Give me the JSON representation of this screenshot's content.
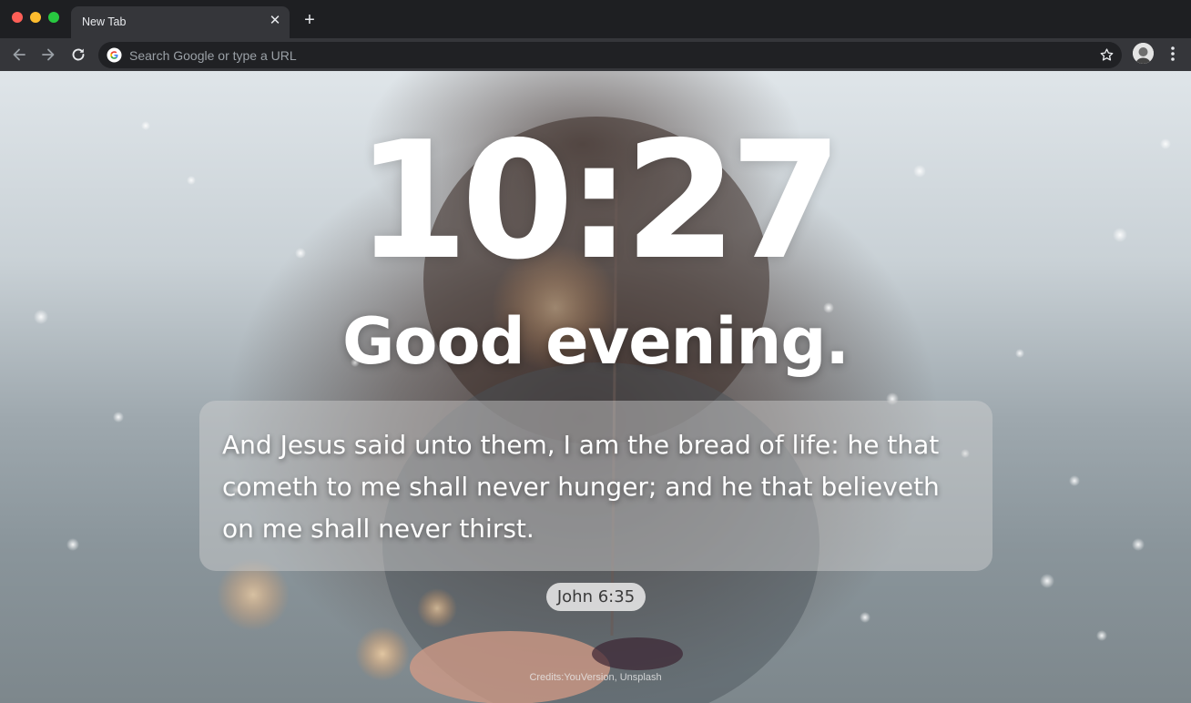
{
  "browser": {
    "tab": {
      "title": "New Tab"
    },
    "omnibox": {
      "placeholder": "Search Google or type a URL"
    },
    "icons": {
      "back": "arrow-left-icon",
      "forward": "arrow-right-icon",
      "reload": "reload-icon",
      "google": "google-g-icon",
      "bookmark": "star-icon",
      "profile": "avatar",
      "menu": "kebab-menu-icon",
      "close": "close-icon",
      "new_tab": "plus-icon"
    }
  },
  "page": {
    "clock": "10:27",
    "greeting": "Good evening.",
    "verse": {
      "text": "And Jesus said unto them, I am the bread of life: he that cometh to me shall never hunger; and he that believeth on me shall never thirst.",
      "reference": "John 6:35"
    },
    "credits": "Credits:YouVersion, Unsplash"
  },
  "colors": {
    "chrome_dark": "#1e1f22",
    "toolbar": "#35363a",
    "omnibox": "#202124",
    "text_white": "#ffffff"
  }
}
